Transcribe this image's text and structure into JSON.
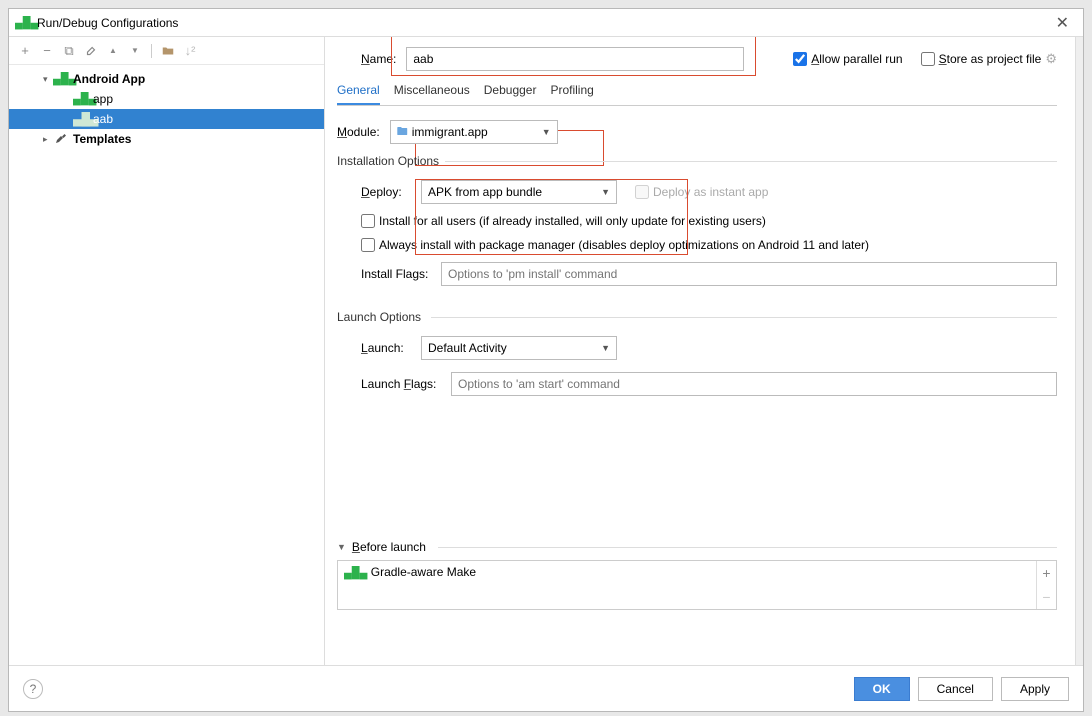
{
  "window": {
    "title": "Run/Debug Configurations"
  },
  "toolbar_icons": {
    "add": "+",
    "remove": "−",
    "copy": "⧉",
    "wrench": "🔧",
    "up": "▲",
    "down": "▼",
    "folder": "🗂",
    "sort": "⇅"
  },
  "tree": {
    "root_label": "Android App",
    "items": [
      {
        "label": "app"
      },
      {
        "label": "aab"
      }
    ],
    "templates_label": "Templates"
  },
  "name": {
    "label": "Name:",
    "value": "aab"
  },
  "allow_parallel": {
    "checked": true,
    "label": "Allow parallel run"
  },
  "store_project": {
    "checked": false,
    "label": "Store as project file"
  },
  "tabs": {
    "general": "General",
    "misc": "Miscellaneous",
    "debugger": "Debugger",
    "profiling": "Profiling"
  },
  "module": {
    "label": "Module:",
    "value": "immigrant.app"
  },
  "install": {
    "title": "Installation Options",
    "deploy_label": "Deploy:",
    "deploy_value": "APK from app bundle",
    "instant_label": "Deploy as instant app",
    "all_users": "Install for all users (if already installed, will only update for existing users)",
    "pkg_mgr": "Always install with package manager (disables deploy optimizations on Android 11 and later)",
    "flags_label": "Install Flags:",
    "flags_placeholder": "Options to 'pm install' command"
  },
  "launch": {
    "title": "Launch Options",
    "launch_label": "Launch:",
    "launch_value": "Default Activity",
    "flags_label": "Launch Flags:",
    "flags_placeholder": "Options to 'am start' command"
  },
  "before_launch": {
    "title": "Before launch",
    "item": "Gradle-aware Make"
  },
  "buttons": {
    "ok": "OK",
    "cancel": "Cancel",
    "apply": "Apply"
  }
}
